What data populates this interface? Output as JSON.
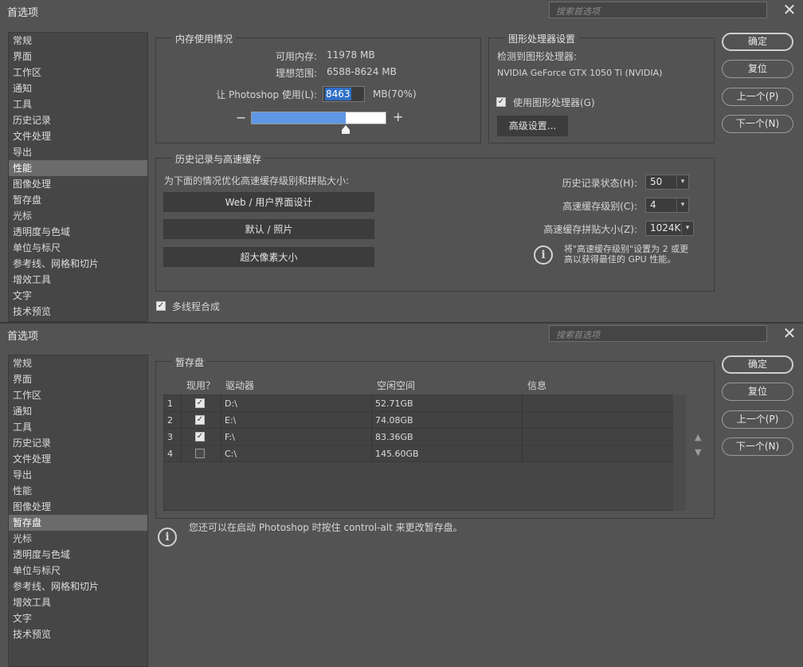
{
  "top": {
    "title": "首选项",
    "search_placeholder": "搜索首选项",
    "close_glyph": "✕",
    "nav": [
      "常规",
      "界面",
      "工作区",
      "通知",
      "工具",
      "历史记录",
      "文件处理",
      "导出",
      "性能",
      "图像处理",
      "暂存盘",
      "光标",
      "透明度与色域",
      "单位与标尺",
      "参考线、网格和切片",
      "增效工具",
      "文字",
      "技术预览"
    ],
    "selected_nav": "性能",
    "memory": {
      "group_label": "内存使用情况",
      "available_label": "可用内存:",
      "available_value": "11978 MB",
      "ideal_label": "理想范围:",
      "ideal_value": "6588-8624 MB",
      "let_label": "让 Photoshop 使用(L):",
      "use_value": "8463",
      "use_unit": "MB(70%)",
      "slider_percent": 70,
      "minus": "−",
      "plus": "+"
    },
    "gpu": {
      "group_label": "图形处理器设置",
      "detected_label": "检测到图形处理器:",
      "gpu_name": "NVIDIA GeForce GTX 1050 Ti (NVIDIA)",
      "use_gpu_label": "使用图形处理器(G)",
      "use_gpu_checked": true,
      "advanced_button": "高级设置..."
    },
    "history": {
      "group_label": "历史记录与高速缓存",
      "optimize_label": "为下面的情况优化高速缓存级别和拼贴大小:",
      "buttons": [
        "Web / 用户界面设计",
        "默认 / 照片",
        "超大像素大小"
      ],
      "history_states_label": "历史记录状态(H):",
      "history_states_value": "50",
      "cache_levels_label": "高速缓存级别(C):",
      "cache_levels_value": "4",
      "cache_tile_label": "高速缓存拼贴大小(Z):",
      "cache_tile_value": "1024K",
      "info_text_1": "将\"高速缓存级别\"设置为 2 或更",
      "info_text_2": "高以获得最佳的 GPU 性能。"
    },
    "multithread_label": "多线程合成",
    "multithread_checked": true,
    "buttons": {
      "ok": "确定",
      "reset": "复位",
      "prev": "上一个(P)",
      "next": "下一个(N)"
    }
  },
  "bottom": {
    "title": "首选项",
    "search_placeholder": "搜索首选项",
    "close_glyph": "✕",
    "nav": [
      "常规",
      "界面",
      "工作区",
      "通知",
      "工具",
      "历史记录",
      "文件处理",
      "导出",
      "性能",
      "图像处理",
      "暂存盘",
      "光标",
      "透明度与色域",
      "单位与标尺",
      "参考线、网格和切片",
      "增效工具",
      "文字",
      "技术预览"
    ],
    "selected_nav": "暂存盘",
    "scratch": {
      "group_label": "暂存盘",
      "columns": [
        "现用？",
        "驱动器",
        "空闲空间",
        "信息"
      ],
      "rows": [
        {
          "num": "1",
          "active": true,
          "drive": "D:\\",
          "free": "52.71GB",
          "info": ""
        },
        {
          "num": "2",
          "active": true,
          "drive": "E:\\",
          "free": "74.08GB",
          "info": ""
        },
        {
          "num": "3",
          "active": true,
          "drive": "F:\\",
          "free": "83.36GB",
          "info": ""
        },
        {
          "num": "4",
          "active": false,
          "drive": "C:\\",
          "free": "145.60GB",
          "info": ""
        }
      ],
      "up_glyph": "▲",
      "down_glyph": "▼"
    },
    "info_text": "您还可以在启动 Photoshop 时按住 control-alt 来更改暂存盘。",
    "buttons": {
      "ok": "确定",
      "reset": "复位",
      "prev": "上一个(P)",
      "next": "下一个(N)"
    }
  }
}
